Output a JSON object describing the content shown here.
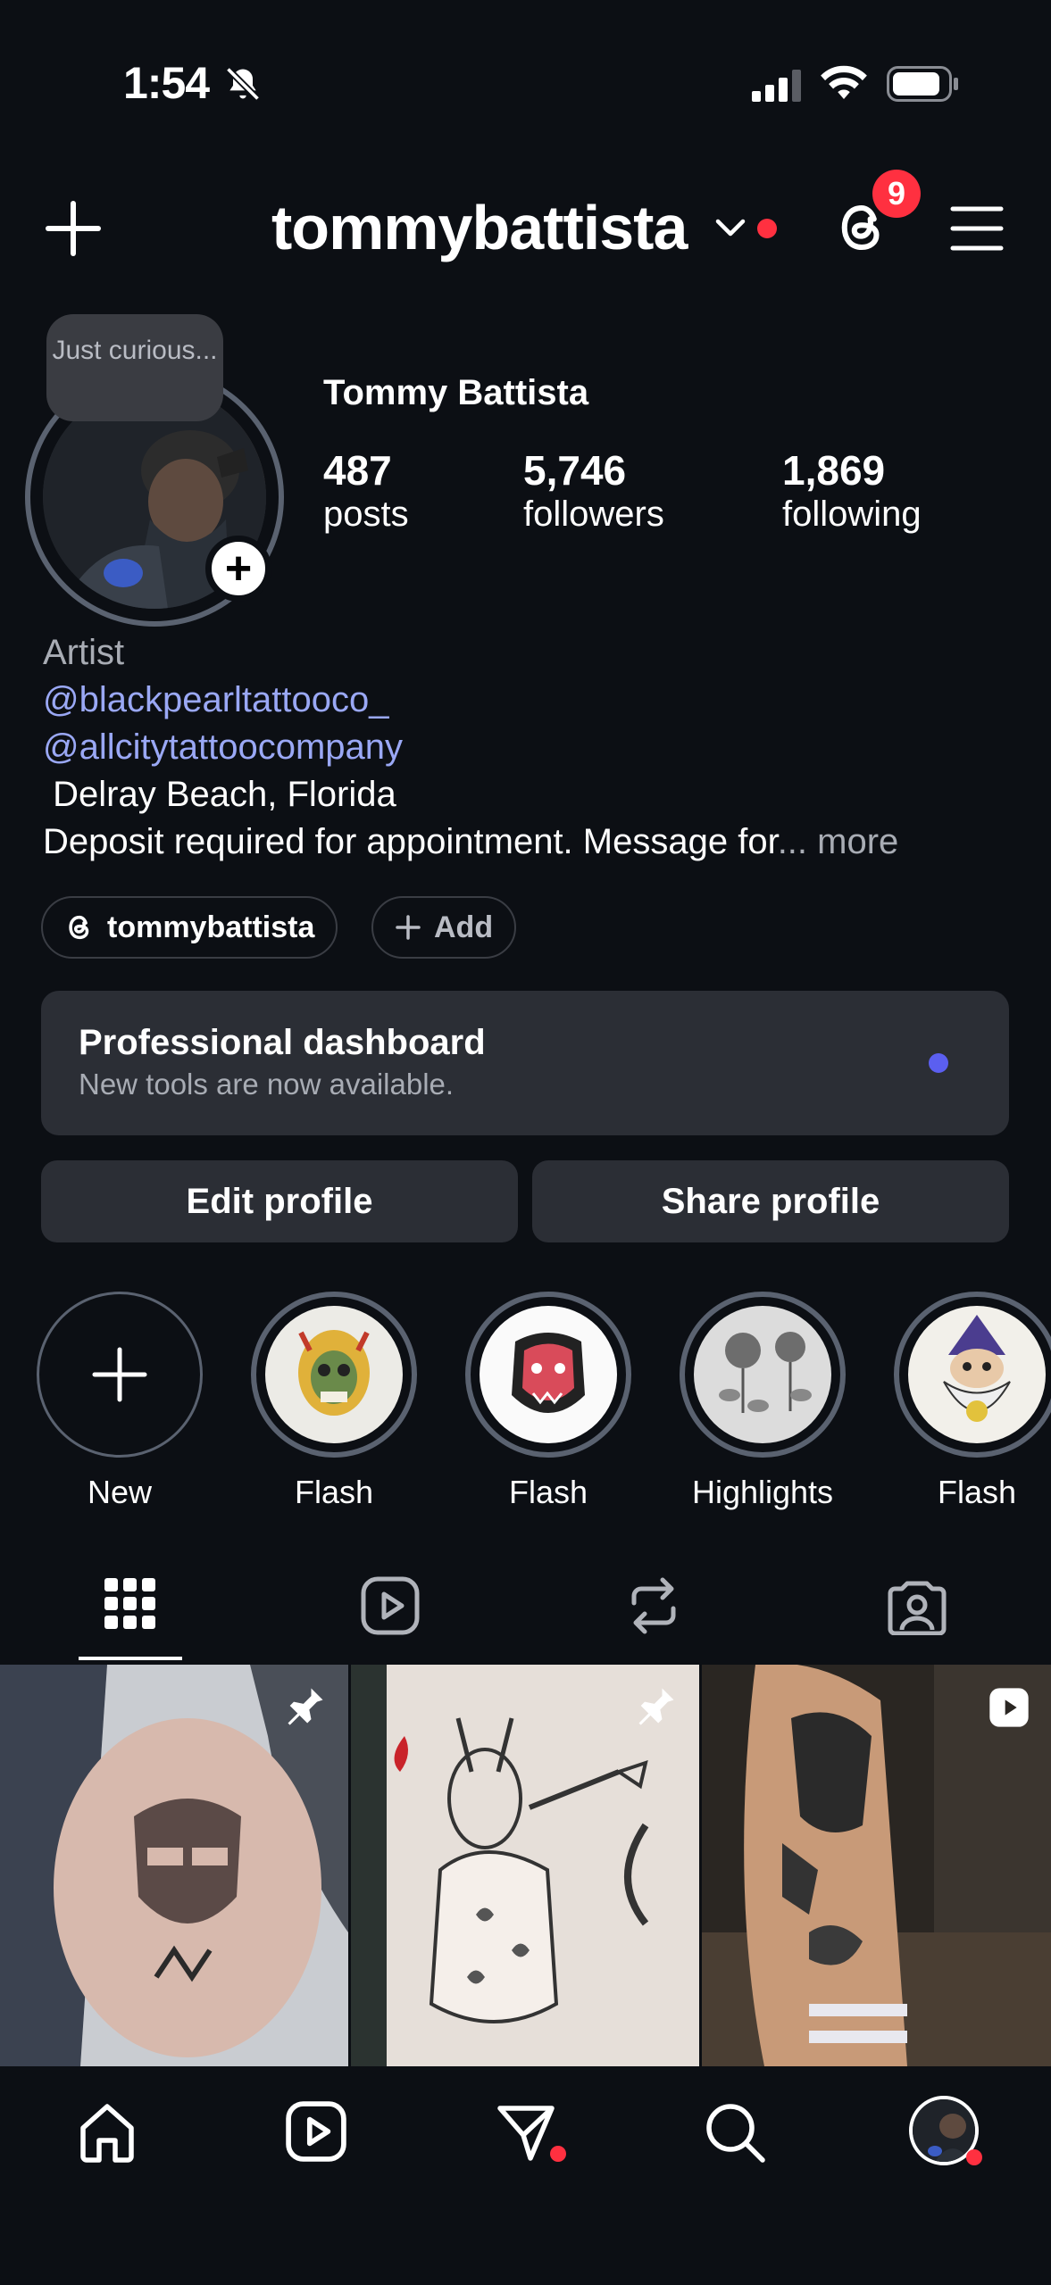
{
  "status_bar": {
    "time": "1:54",
    "icons": [
      "bell-slash-icon",
      "signal-icon",
      "wifi-icon",
      "battery-icon"
    ]
  },
  "header": {
    "username": "tommybattista",
    "notification_count": "9",
    "icons": [
      "plus-icon",
      "chevron-down-icon",
      "threads-icon",
      "menu-icon"
    ]
  },
  "profile": {
    "note": "Just curious...",
    "full_name": "Tommy Battista",
    "stats": [
      {
        "value": "487",
        "label": "posts"
      },
      {
        "value": "5,746",
        "label": "followers"
      },
      {
        "value": "1,869",
        "label": "following"
      }
    ],
    "category": "Artist",
    "links": [
      "@blackpearltattooco_",
      "@allcitytattoocompany"
    ],
    "location": " Delray Beach, Florida",
    "bio_line": "Deposit required for appointment. Message for",
    "more": "... more"
  },
  "pills": {
    "threads": "tommybattista",
    "add": "Add"
  },
  "dashboard": {
    "title": "Professional dashboard",
    "subtitle": "New tools are now available."
  },
  "buttons": {
    "edit": "Edit profile",
    "share": "Share profile"
  },
  "highlights": [
    {
      "label": "New"
    },
    {
      "label": "Flash"
    },
    {
      "label": "Flash"
    },
    {
      "label": "Highlights"
    },
    {
      "label": "Flash"
    }
  ],
  "tabs": [
    "grid-icon",
    "reels-icon",
    "reposts-icon",
    "tagged-icon"
  ],
  "nav": [
    "home-icon",
    "reels-icon",
    "send-icon",
    "search-icon",
    "profile-avatar"
  ],
  "colors": {
    "background": "#0c0f14",
    "accent_red": "#ff3040",
    "link": "#9aa8f5",
    "card": "#2b2e35"
  }
}
